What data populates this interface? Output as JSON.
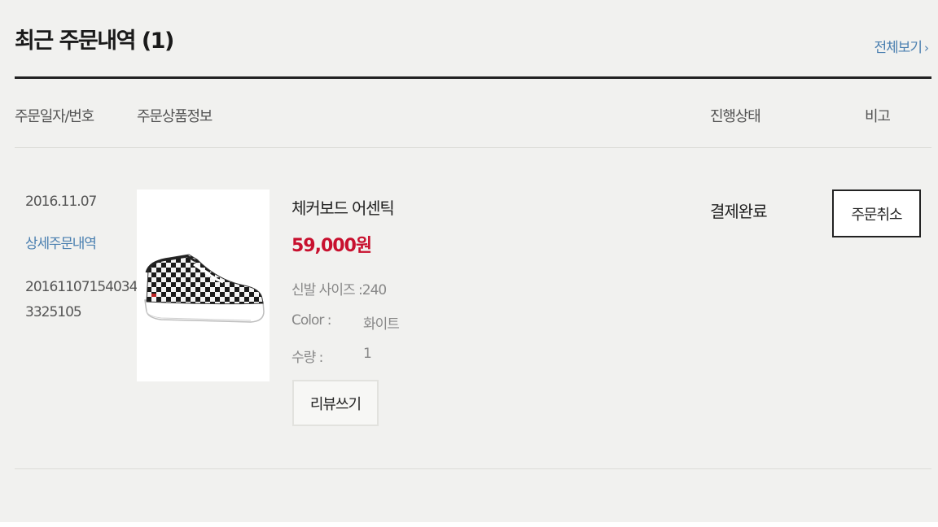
{
  "section": {
    "title": "최근 주문내역 (1)",
    "view_all_label": "전체보기",
    "view_all_icon": "chevron-right-icon"
  },
  "table": {
    "headers": {
      "date_number": "주문일자/번호",
      "product_info": "주문상품정보",
      "status": "진행상태",
      "note": "비고"
    },
    "order": {
      "date": "2016.11.07",
      "detail_link": "상세주문내역",
      "number_line1": "20161107154034",
      "number_line2": "3325105",
      "product_name": "체커보드 어센틱",
      "price": "59,000원",
      "options": {
        "size_label": "신발 사이즈 :",
        "size_value": "240",
        "color_label": "Color :",
        "color_value": "화이트",
        "qty_label": "수량 :",
        "qty_value": "1"
      },
      "review_button": "리뷰쓰기",
      "status": "결제완료",
      "cancel_button": "주문취소"
    }
  },
  "colors": {
    "accent_link": "#4a7fb0",
    "price_red": "#c8102e",
    "background": "#f1f1ef"
  }
}
